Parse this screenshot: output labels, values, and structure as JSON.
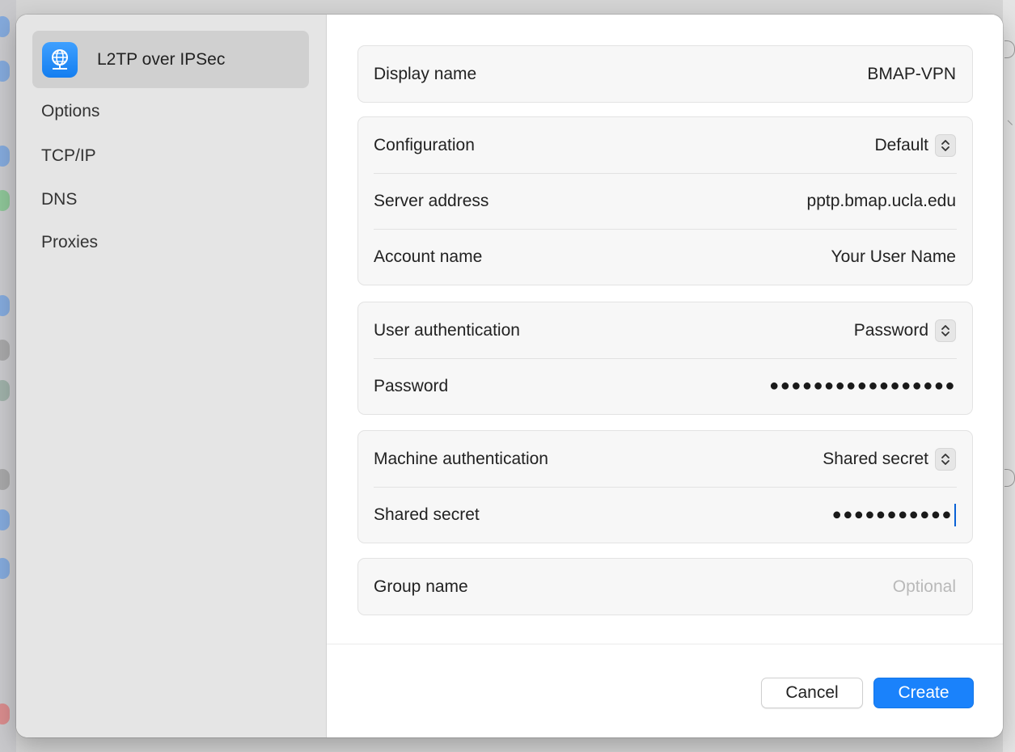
{
  "sidebar": {
    "header": {
      "title": "L2TP over IPSec",
      "icon": "globe-network-icon"
    },
    "items": [
      {
        "label": "Options"
      },
      {
        "label": "TCP/IP"
      },
      {
        "label": "DNS"
      },
      {
        "label": "Proxies"
      }
    ]
  },
  "form": {
    "display_name": {
      "label": "Display name",
      "value": "BMAP-VPN"
    },
    "configuration": {
      "label": "Configuration",
      "value": "Default"
    },
    "server_address": {
      "label": "Server address",
      "value": "pptp.bmap.ucla.edu"
    },
    "account_name": {
      "label": "Account name",
      "value": "Your User Name"
    },
    "user_authentication": {
      "label": "User authentication",
      "value": "Password"
    },
    "password": {
      "label": "Password",
      "value": "●●●●●●●●●●●●●●●●●"
    },
    "machine_authentication": {
      "label": "Machine authentication",
      "value": "Shared secret"
    },
    "shared_secret": {
      "label": "Shared secret",
      "value": "●●●●●●●●●●●"
    },
    "group_name": {
      "label": "Group name",
      "placeholder": "Optional"
    }
  },
  "buttons": {
    "cancel": "Cancel",
    "create": "Create"
  },
  "colors": {
    "accent": "#1a82fb",
    "sidebar_bg": "#e5e5e5",
    "selected_bg": "#d0d0d0"
  }
}
